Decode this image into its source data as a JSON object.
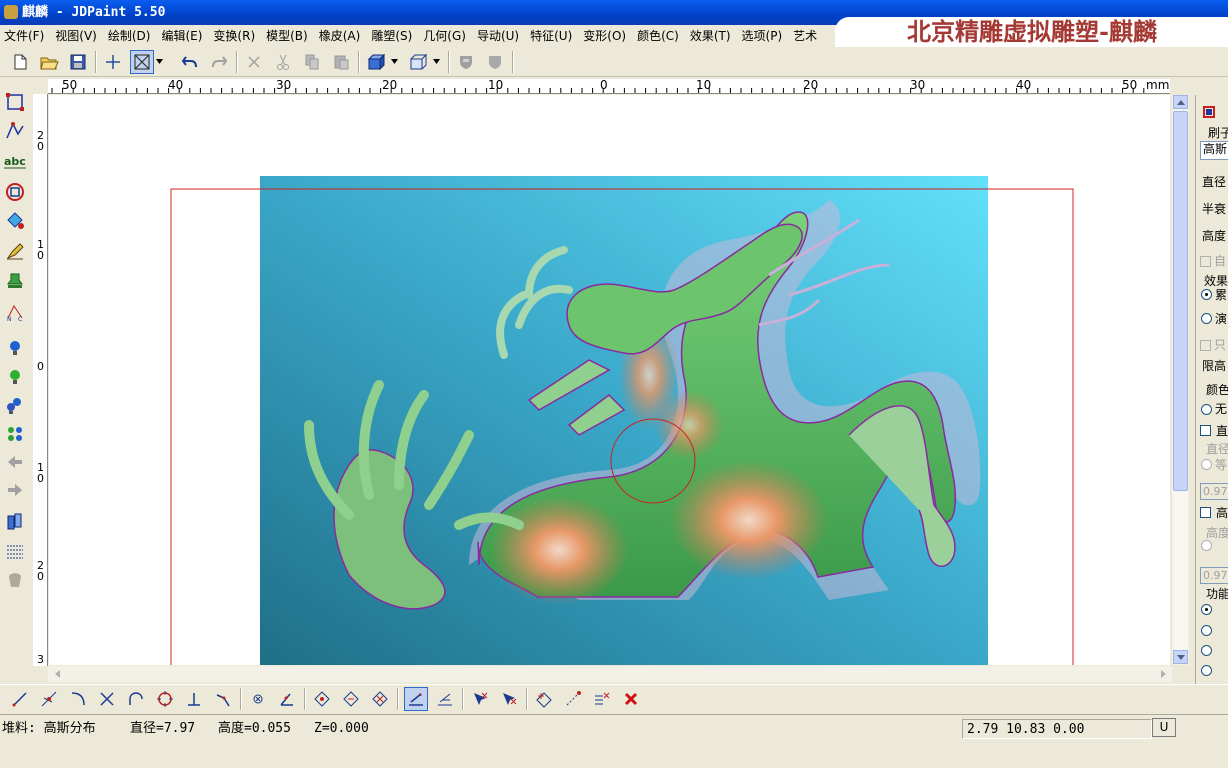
{
  "window": {
    "title": "麒麟 - JDPaint 5.50"
  },
  "banner": {
    "text": "北京精雕虚拟雕塑-麒麟"
  },
  "menu": {
    "items": [
      "文件(F)",
      "视图(V)",
      "绘制(D)",
      "编辑(E)",
      "变换(R)",
      "模型(B)",
      "橡皮(A)",
      "雕塑(S)",
      "几何(G)",
      "导动(U)",
      "特征(U)",
      "变形(O)",
      "颜色(C)",
      "效果(T)",
      "选项(P)",
      "艺术"
    ]
  },
  "ruler": {
    "h_labels": [
      "50",
      "40",
      "30",
      "20",
      "10",
      "0",
      "10",
      "20",
      "30",
      "40",
      "50",
      "mm"
    ],
    "v_labels": [
      "2\n0",
      "1\n0",
      "0",
      "1\n0",
      "2\n0",
      "3"
    ]
  },
  "panel": {
    "brush_label": "刷子",
    "brush_value": "高斯",
    "diameter_label": "直径",
    "half_decay_label": "半衰",
    "height_label": "高度",
    "auto_label": "自",
    "effect_label": "效果",
    "effect_opt1": "累",
    "effect_opt2": "演",
    "only_label": "只",
    "limit_height_label": "限高",
    "color_label": "颜色",
    "color_opt1": "无",
    "direct_label": "直",
    "diameter2_label": "直径",
    "diameter2_opt": "等",
    "val1": "0.97",
    "height2_label": "高",
    "height3_label": "高度",
    "val2": "0.97",
    "function_label": "功能",
    "func_opt1": "",
    "func_opt2": "",
    "func_opt3": "",
    "func_opt4": ""
  },
  "status": {
    "material": "堆料: 高斯分布",
    "diameter": "直径=7.97",
    "height": "高度=0.055",
    "z": "Z=0.000",
    "coords": "2.79 10.83 0.00",
    "unit_button": "U"
  },
  "colors": {
    "titlebar": "#0a5ef0",
    "bg_relief": "#3aa7c8",
    "body_green": "#4cae5a",
    "body_orange": "#e08a5a",
    "outline_magenta": "#8a2aa0",
    "bounds_red": "#cc2020",
    "banner_text": "#a53a35"
  }
}
